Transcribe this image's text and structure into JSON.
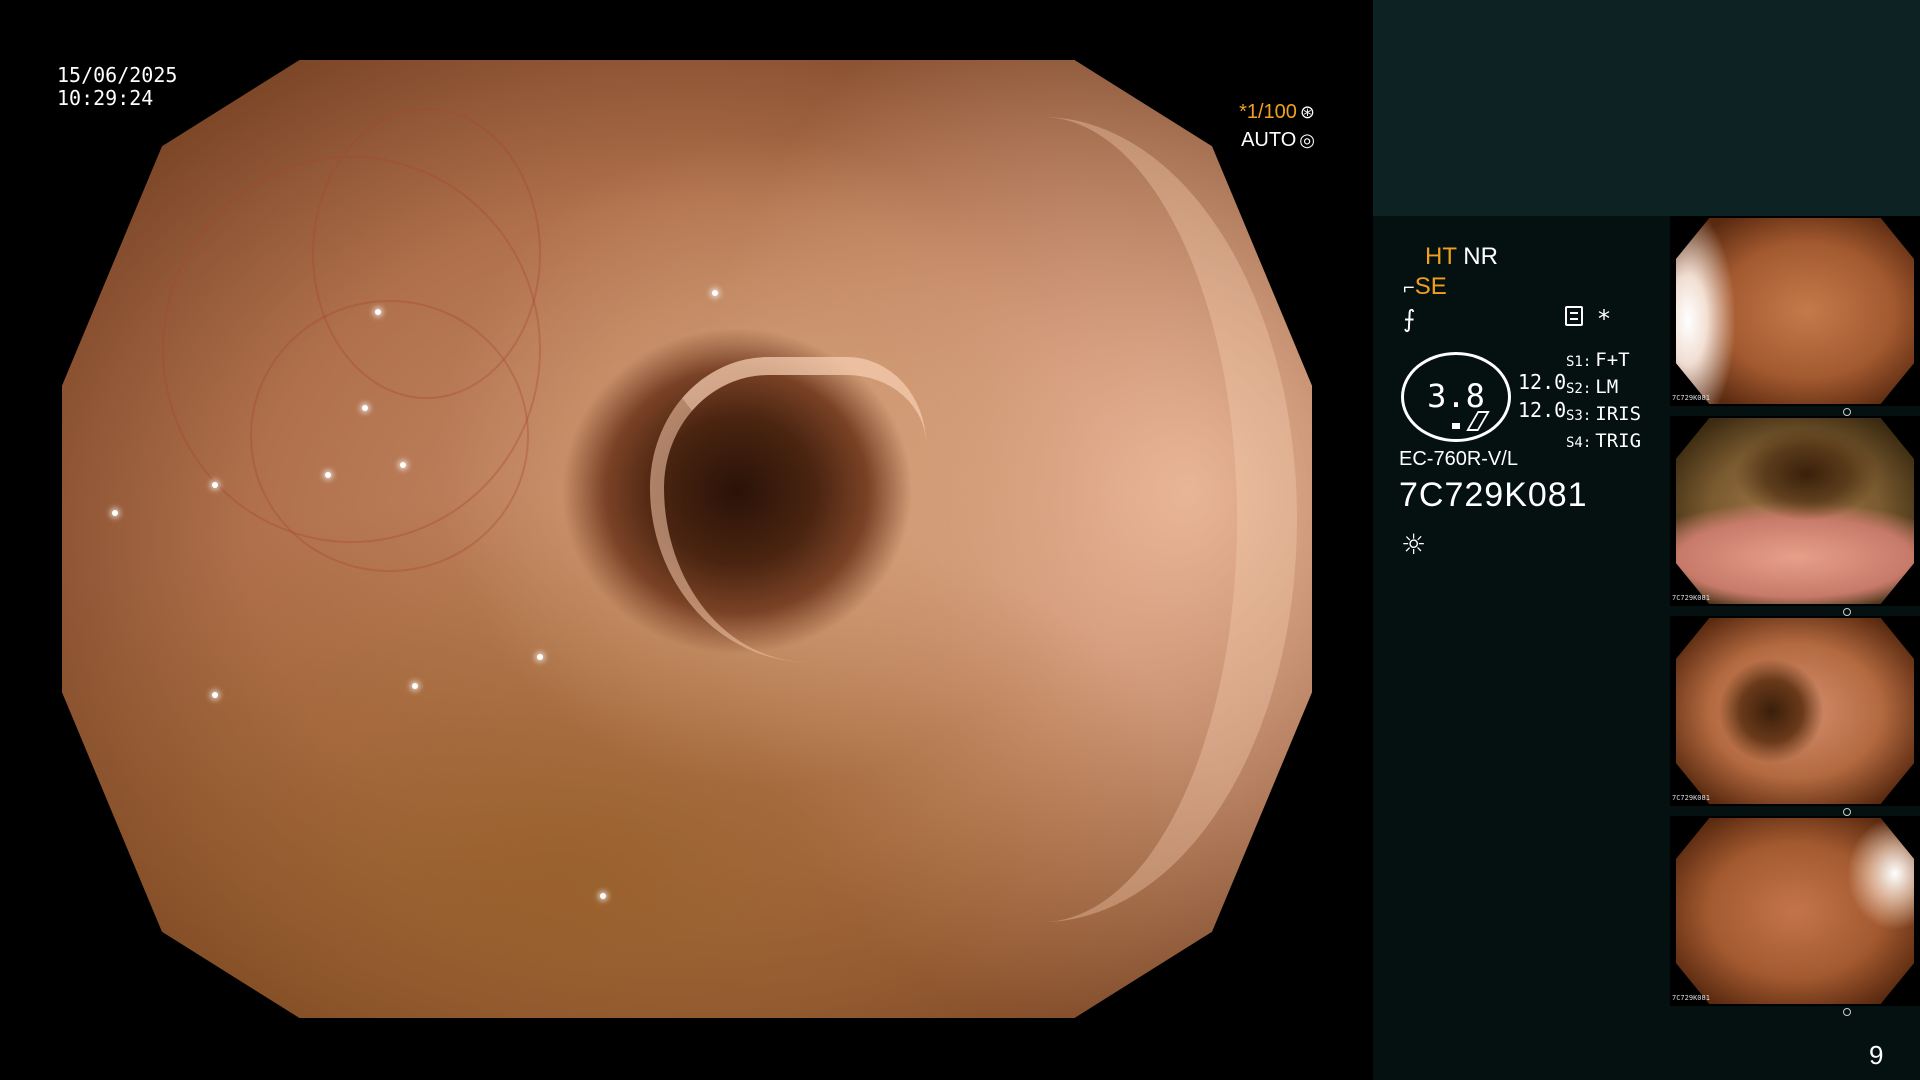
{
  "overlay": {
    "date": "15/06/2025",
    "time": "10:29:24",
    "shutter_speed": "*1/100",
    "exposure_mode": "AUTO"
  },
  "panel": {
    "mode_ht": "HT",
    "mode_nr": "NR",
    "mode_se": "SE",
    "gauge_value": "3.8",
    "gauge_top": "12.0",
    "gauge_bottom": "12.0",
    "switches": [
      {
        "key": "S1:",
        "value": "F+T"
      },
      {
        "key": "S2:",
        "value": "LM"
      },
      {
        "key": "S3:",
        "value": "IRIS"
      },
      {
        "key": "S4:",
        "value": "TRIG"
      }
    ],
    "scope_model": "EC-760R-V/L",
    "scope_serial": "7C729K081"
  },
  "thumbnails": [
    {
      "name": "captured-image-1",
      "label": "7C729K081"
    },
    {
      "name": "captured-image-2",
      "label": "7C729K081"
    },
    {
      "name": "captured-image-3",
      "label": "7C729K081"
    },
    {
      "name": "captured-image-4",
      "label": "7C729K081"
    }
  ],
  "page_number": "9",
  "icons": {
    "shutter": "aperture-icon",
    "auto": "iris-icon",
    "sharpness": "sharpness-icon",
    "memo": "list-icon",
    "light": "sun-icon"
  },
  "colors": {
    "highlight": "#f0a020",
    "panel_bg": "#0a1515",
    "panel_top": "#0d2222"
  }
}
